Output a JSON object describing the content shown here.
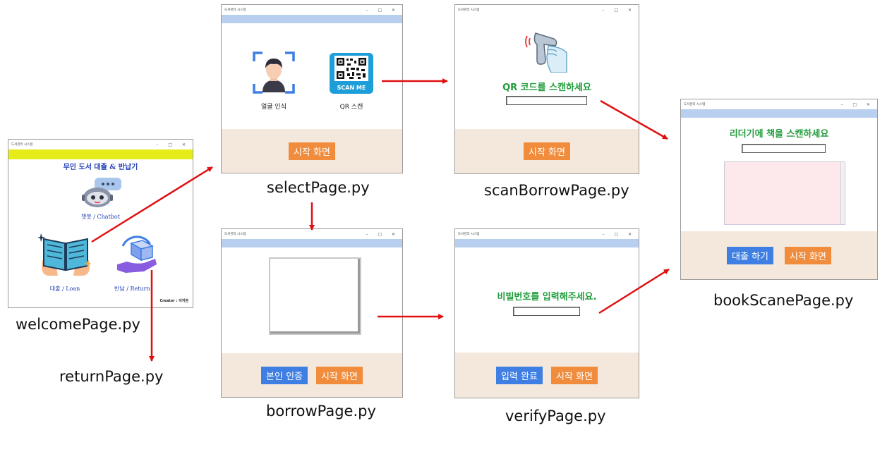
{
  "window_title": "도서관리 시스템",
  "window_controls": "– □ ✕",
  "welcome": {
    "title": "무인 도서 대출 & 반납기",
    "chatbot_label": "챗봇 / Chatbot",
    "loan_label": "대출 / Loan",
    "return_label": "반납 / Return",
    "creator": "Creator : 이지현"
  },
  "select": {
    "face_label": "얼굴 인식",
    "qr_label": "QR 스캔",
    "qr_badge": "SCAN ME",
    "home_button": "시작 화면"
  },
  "scan_borrow": {
    "prompt": "QR 코드를 스캔하세요",
    "home_button": "시작 화면"
  },
  "book_scan": {
    "prompt": "리더기에 책을 스캔하세요",
    "borrow_button": "대출 하기",
    "home_button": "시작 화면"
  },
  "borrow": {
    "verify_button": "본인 인증",
    "home_button": "시작 화면"
  },
  "verify": {
    "prompt": "비빌번호를 입력해주세요.",
    "done_button": "입력 완료",
    "home_button": "시작 화면"
  },
  "captions": {
    "welcome": "welcomePage.py",
    "return": "returnPage.py",
    "select": "selectPage.py",
    "scan_borrow": "scanBorrowPage.py",
    "book_scan": "bookScanePage.py",
    "borrow": "borrowPage.py",
    "verify": "verifyPage.py"
  },
  "colors": {
    "arrow": "#e01010",
    "header_band": "#b8cff0",
    "welcome_band": "#e6ec1a",
    "footer": "#f4e8dc",
    "orange_button": "#f08c3c",
    "blue_button": "#3f7fe4",
    "prompt_green": "#1f9d3a"
  }
}
